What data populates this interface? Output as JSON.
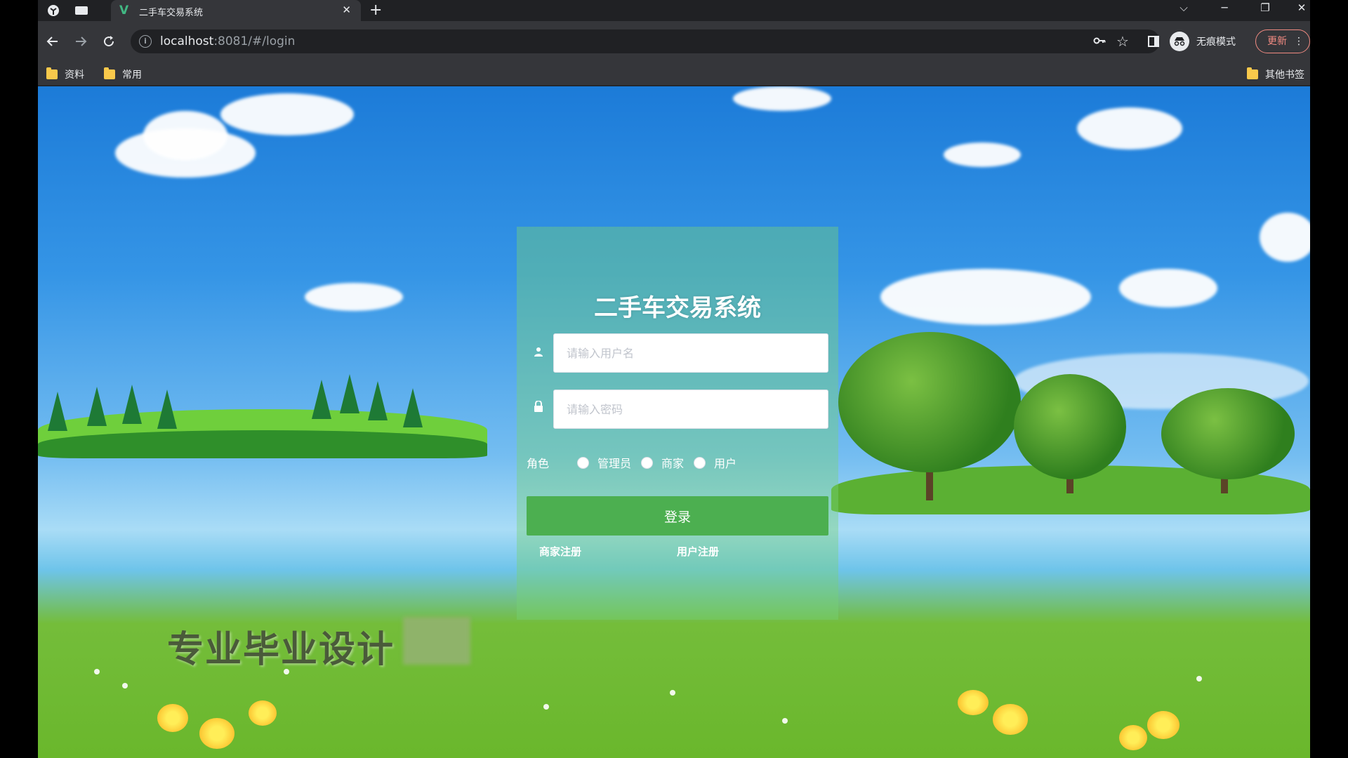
{
  "browser": {
    "tab_title": "二手车交易系统",
    "url_host": "localhost",
    "url_rest": ":8081/#/login",
    "incognito_label": "无痕模式",
    "update_label": "更新",
    "bookmarks": [
      "资料",
      "常用"
    ],
    "other_bookmarks": "其他书签"
  },
  "login": {
    "title": "二手车交易系统",
    "username_placeholder": "请输入用户名",
    "password_placeholder": "请输入密码",
    "role_label": "角色",
    "roles": [
      "管理员",
      "商家",
      "用户"
    ],
    "login_button": "登录",
    "merchant_register": "商家注册",
    "user_register": "用户注册"
  },
  "watermark": "专业毕业设计"
}
